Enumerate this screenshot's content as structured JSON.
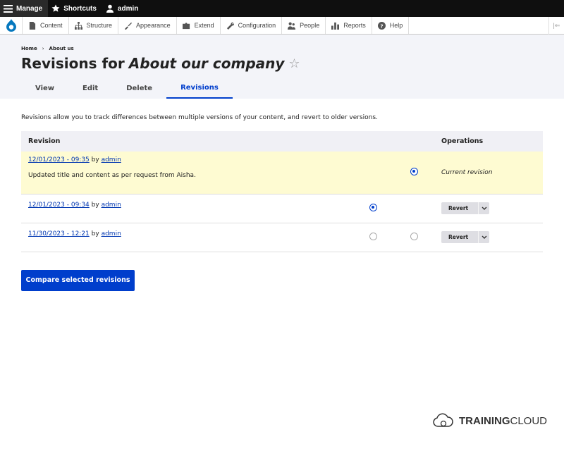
{
  "toolbar": {
    "manage": "Manage",
    "shortcuts": "Shortcuts",
    "user": "admin"
  },
  "tray": {
    "items": [
      "Content",
      "Structure",
      "Appearance",
      "Extend",
      "Configuration",
      "People",
      "Reports",
      "Help"
    ]
  },
  "header": {
    "breadcrumb": [
      "Home",
      "About us"
    ],
    "breadcrumb_sep": "›",
    "title_prefix": "Revisions for",
    "title_em": "About our company",
    "star": "☆",
    "tabs": [
      "View",
      "Edit",
      "Delete",
      "Revisions"
    ],
    "active_tab": "Revisions"
  },
  "main": {
    "intro": "Revisions allow you to track differences between multiple versions of your content, and revert to older versions.",
    "columns": [
      "Revision",
      "Operations"
    ],
    "by_word": "by",
    "rows": [
      {
        "date": "12/01/2023 - 09:35",
        "author": "admin",
        "message": "Updated title and content as per request from Aisha.",
        "operation": "Current revision"
      },
      {
        "date": "12/01/2023 - 09:34",
        "author": "admin",
        "operation": "Revert"
      },
      {
        "date": "11/30/2023 - 12:21",
        "author": "admin",
        "operation": "Revert"
      }
    ],
    "compare_button": "Compare selected revisions"
  },
  "brand": {
    "bold": "TRAINING",
    "rest": "CLOUD"
  },
  "colors": {
    "accent": "#003ecc",
    "current_row": "#fefbd2",
    "toolbar": "#0f0f0f"
  }
}
